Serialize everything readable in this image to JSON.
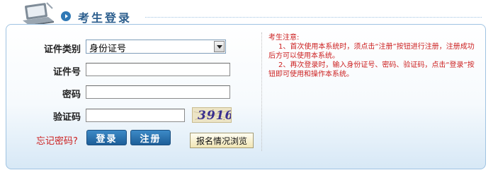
{
  "header": {
    "title": "考生登录"
  },
  "form": {
    "id_type_label": "证件类别",
    "id_type_value": "身份证号",
    "id_number_label": "证件号",
    "id_number_value": "",
    "password_label": "密码",
    "password_value": "",
    "captcha_label": "验证码",
    "captcha_value": "",
    "captcha_code": "3916",
    "forgot_password": "忘记密码?",
    "login_button": "登录",
    "register_button": "注册",
    "browse_button": "报名情况浏览"
  },
  "notice": {
    "heading": "考生注意:",
    "item1": "1、首次使用本系统时，须点击“注册”按钮进行注册，注册成功后方可以使用本系统。",
    "item2": "2、再次登录时，输入身份证号、密码、验证码，点击“登录”按钮即可使用和操作本系统。"
  },
  "colors": {
    "accent_blue": "#2f78b5",
    "title_blue": "#2d5f8e",
    "notice_red": "#cc1f1f",
    "panel_border": "#9fc3e2"
  }
}
